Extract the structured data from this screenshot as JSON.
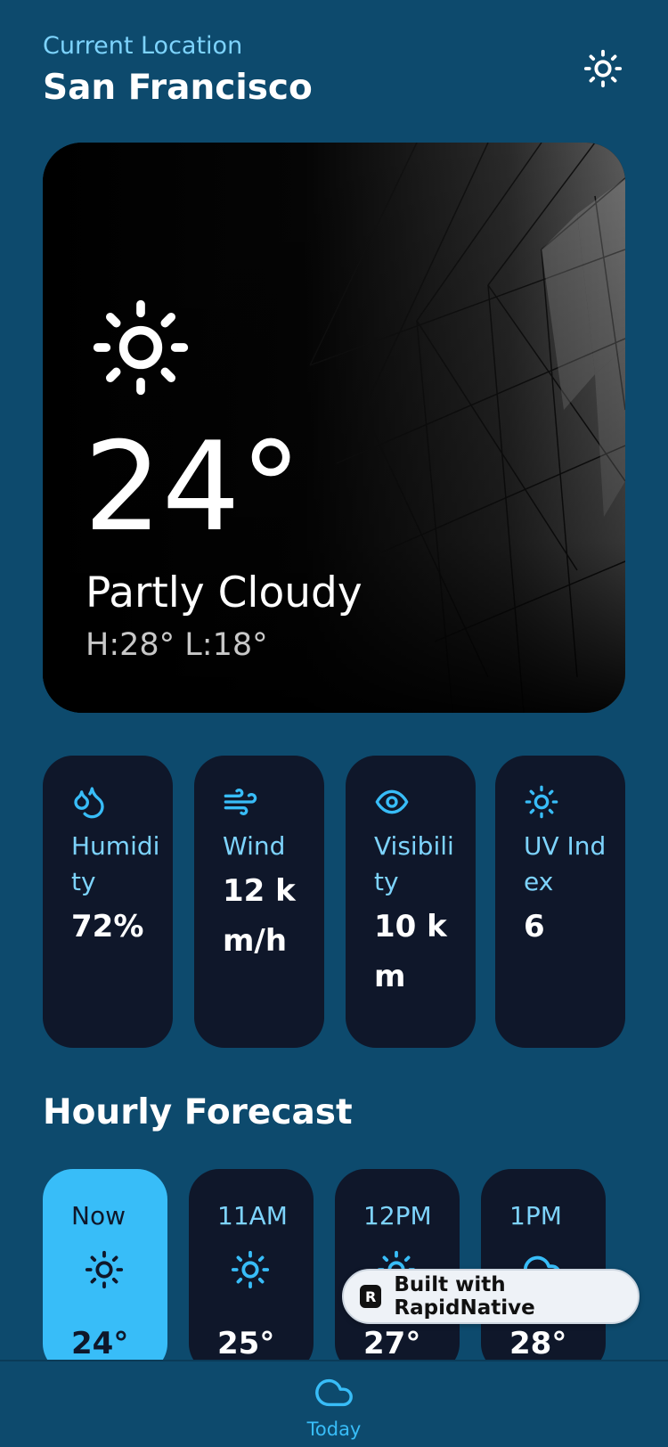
{
  "header": {
    "location_label": "Current Location",
    "city": "San Francisco",
    "theme_icon": "sun-icon"
  },
  "current": {
    "icon": "sun-icon",
    "temperature": "24°",
    "condition": "Partly Cloudy",
    "high_low": "H:28° L:18°"
  },
  "stats": [
    {
      "icon": "droplets-icon",
      "label": "Humidity",
      "value": "72%"
    },
    {
      "icon": "wind-icon",
      "label": "Wind",
      "value": "12 km/h"
    },
    {
      "icon": "eye-icon",
      "label": "Visibility",
      "value": "10 km"
    },
    {
      "icon": "sun-icon",
      "label": "UV Index",
      "value": "6"
    }
  ],
  "hourly_title": "Hourly Forecast",
  "hourly": [
    {
      "time": "Now",
      "icon": "sun-icon",
      "temp": "24°",
      "active": true
    },
    {
      "time": "11AM",
      "icon": "sun-icon",
      "temp": "25°",
      "active": false
    },
    {
      "time": "12PM",
      "icon": "sun-icon",
      "temp": "27°",
      "active": false
    },
    {
      "time": "1PM",
      "icon": "cloud-icon",
      "temp": "28°",
      "active": false
    }
  ],
  "badge": {
    "text": "Built with RapidNative",
    "logo": "R"
  },
  "tabbar": {
    "today_label": "Today",
    "today_icon": "cloud-icon"
  },
  "colors": {
    "background": "#0d4a6d",
    "card": "#0f172a",
    "accent": "#38bdf8",
    "label": "#7dd3fc"
  }
}
